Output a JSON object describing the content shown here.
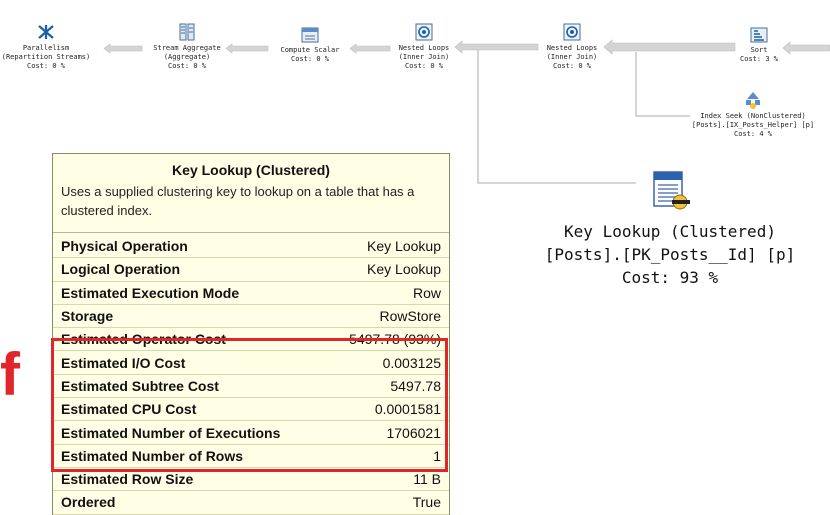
{
  "plan": {
    "operators": [
      {
        "id": "parallelism",
        "icon": "parallelism-icon",
        "lines": [
          "Parallelism",
          "(Repartition Streams)",
          "Cost: 0 %"
        ]
      },
      {
        "id": "stream-aggregate",
        "icon": "stream-aggregate-icon",
        "lines": [
          "Stream Aggregate",
          "(Aggregate)",
          "Cost: 0 %"
        ]
      },
      {
        "id": "compute-scalar",
        "icon": "compute-scalar-icon",
        "lines": [
          "Compute Scalar",
          "Cost: 0 %"
        ]
      },
      {
        "id": "nested-loops-1",
        "icon": "nested-loops-icon",
        "lines": [
          "Nested Loops",
          "(Inner Join)",
          "Cost: 0 %"
        ]
      },
      {
        "id": "nested-loops-2",
        "icon": "nested-loops-icon",
        "lines": [
          "Nested Loops",
          "(Inner Join)",
          "Cost: 0 %"
        ]
      },
      {
        "id": "sort",
        "icon": "sort-icon",
        "lines": [
          "Sort",
          "Cost: 3 %"
        ]
      },
      {
        "id": "index-seek",
        "icon": "index-seek-icon",
        "lines": [
          "Index Seek (NonClustered)",
          "[Posts].[IX_Posts_Helper] [p]",
          "Cost: 4 %"
        ]
      }
    ],
    "key_lookup": {
      "icon": "key-lookup-icon",
      "title": "Key Lookup (Clustered)",
      "object": "[Posts].[PK_Posts__Id] [p]",
      "cost": "Cost: 93 %"
    }
  },
  "tooltip": {
    "title": "Key Lookup (Clustered)",
    "description": "Uses a supplied clustering key to lookup on a table that has a clustered index.",
    "rows": [
      {
        "k": "Physical Operation",
        "v": "Key Lookup"
      },
      {
        "k": "Logical Operation",
        "v": "Key Lookup"
      },
      {
        "k": "Estimated Execution Mode",
        "v": "Row"
      },
      {
        "k": "Storage",
        "v": "RowStore"
      },
      {
        "k": "Estimated Operator Cost",
        "v": "5497.78 (93%)"
      },
      {
        "k": "Estimated I/O Cost",
        "v": "0.003125"
      },
      {
        "k": "Estimated Subtree Cost",
        "v": "5497.78"
      },
      {
        "k": "Estimated CPU Cost",
        "v": "0.0001581"
      },
      {
        "k": "Estimated Number of Executions",
        "v": "1706021"
      },
      {
        "k": "Estimated Number of Rows",
        "v": "1"
      },
      {
        "k": "Estimated Row Size",
        "v": "11 B"
      },
      {
        "k": "Ordered",
        "v": "True"
      }
    ]
  },
  "annotation": {
    "mark": "f",
    "color": "#e0262a"
  },
  "colors": {
    "tooltip_bg": "#ffffe6",
    "arrow": "#cfcfcf",
    "highlight": "#e0262a"
  }
}
